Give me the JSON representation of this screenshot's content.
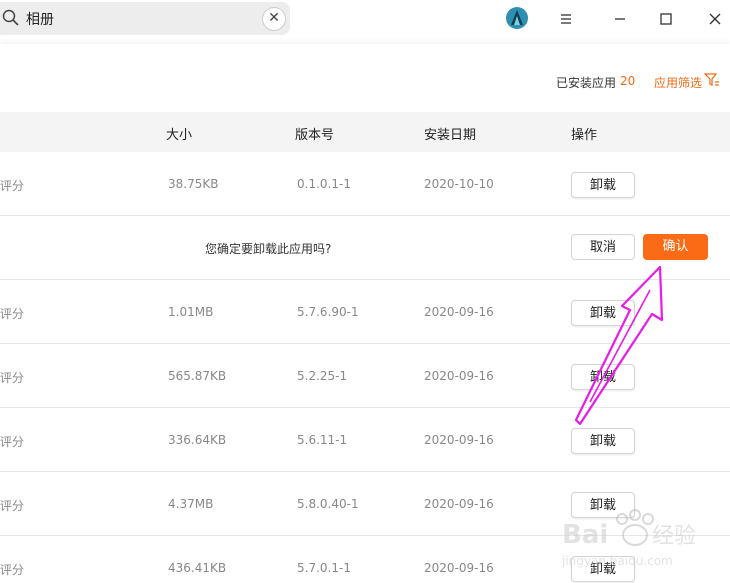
{
  "search": {
    "value": "相册"
  },
  "filterbar": {
    "installed_label": "已安装应用",
    "installed_count": "20",
    "filter_label": "应用筛选"
  },
  "table": {
    "headers": {
      "size": "大小",
      "version": "版本号",
      "install_date": "安装日期",
      "action": "操作"
    },
    "rating_text": "评分",
    "rows": [
      {
        "size": "38.75KB",
        "version": "0.1.0.1-1",
        "date": "2020-10-10",
        "action": "卸载"
      },
      {
        "size": "1.01MB",
        "version": "5.7.6.90-1",
        "date": "2020-09-16",
        "action": "卸载"
      },
      {
        "size": "565.87KB",
        "version": "5.2.25-1",
        "date": "2020-09-16",
        "action": "卸载"
      },
      {
        "size": "336.64KB",
        "version": "5.6.11-1",
        "date": "2020-09-16",
        "action": "卸载"
      },
      {
        "size": "4.37MB",
        "version": "5.8.0.40-1",
        "date": "2020-09-16",
        "action": "卸载"
      },
      {
        "size": "436.41KB",
        "version": "5.7.0.1-1",
        "date": "2020-09-16",
        "action": "卸载"
      }
    ]
  },
  "confirm": {
    "question": "您确定要卸载此应用吗?",
    "cancel": "取消",
    "ok": "确认"
  },
  "icons": {
    "search": "search-icon",
    "clear": "close-icon",
    "logo": "app-logo-icon",
    "menu": "menu-icon",
    "minimize": "minimize-icon",
    "maximize": "maximize-icon",
    "close": "close-icon",
    "filter": "filter-icon"
  },
  "colors": {
    "accent": "#fb6a14",
    "arrow": "#e81ce8"
  }
}
